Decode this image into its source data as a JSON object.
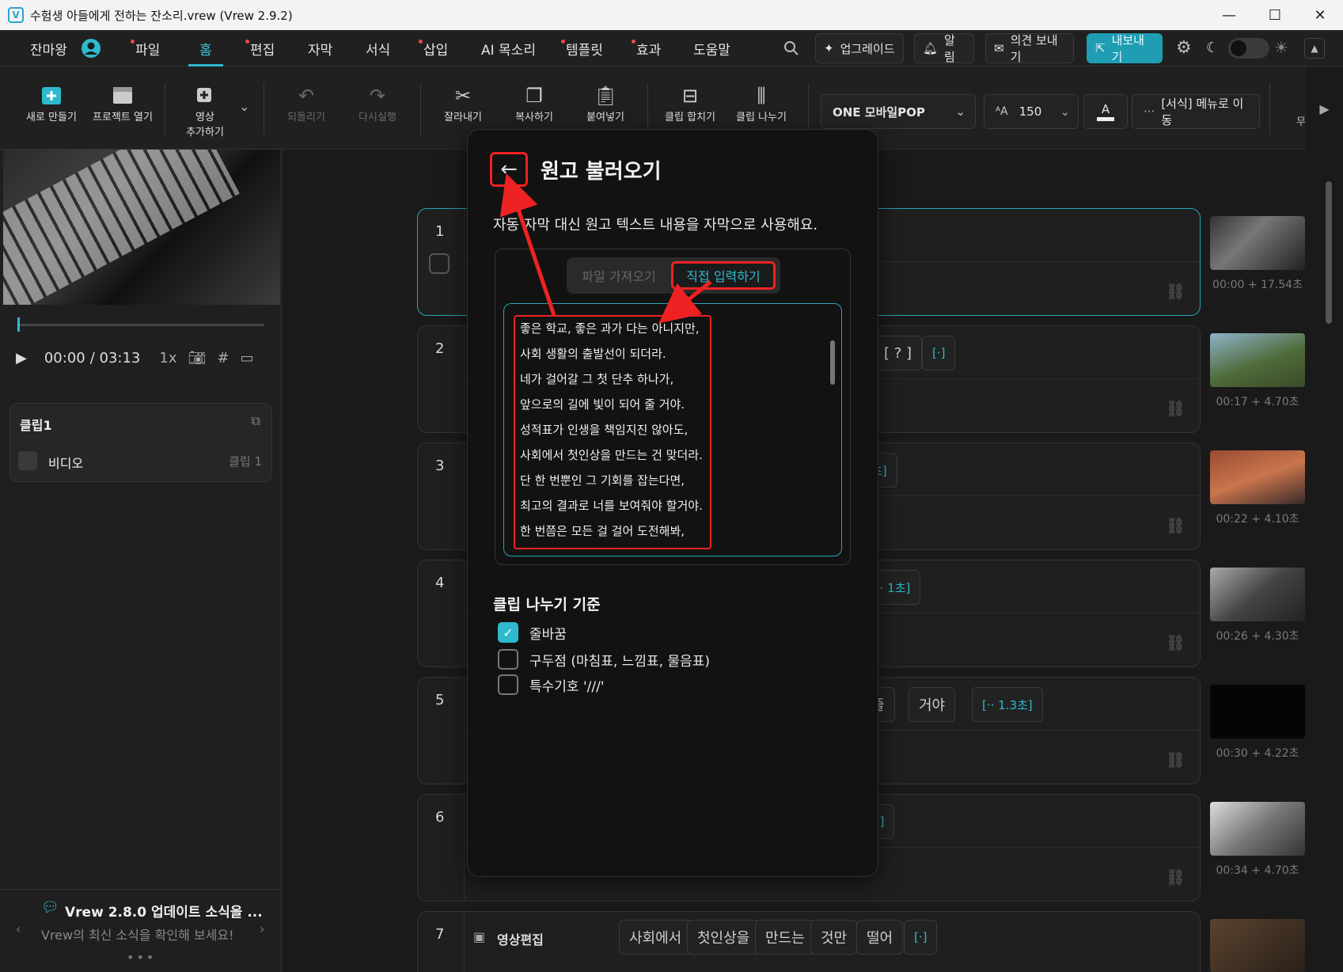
{
  "window": {
    "title": "수험생 아들에게 전하는 잔소리.vrew (Vrew 2.9.2)",
    "logo_text": "V",
    "controls": [
      "—",
      "☐",
      "✕"
    ]
  },
  "menubar": {
    "user": "잔마왕",
    "items": [
      {
        "label": "파일",
        "dot": true
      },
      {
        "label": "홈",
        "dot": false,
        "active": true
      },
      {
        "label": "편집",
        "dot": true
      },
      {
        "label": "자막",
        "dot": false
      },
      {
        "label": "서식",
        "dot": false
      },
      {
        "label": "삽입",
        "dot": true
      },
      {
        "label": "AI 목소리",
        "dot": false
      },
      {
        "label": "템플릿",
        "dot": true
      },
      {
        "label": "효과",
        "dot": true
      },
      {
        "label": "도움말",
        "dot": false
      }
    ],
    "upgrade": "업그레이드",
    "alarm": "알림",
    "feedback": "의견 보내기",
    "export": "내보내기"
  },
  "toolbar": {
    "new": "새로 만들기",
    "open": "프로젝트 열기",
    "add_video_1": "영상",
    "add_video_2": "추가하기",
    "undo": "되돌리기",
    "redo": "다시실행",
    "cut": "잘라내기",
    "copy": "복사하기",
    "paste": "붙여넣기",
    "merge": "클립 합치기",
    "split": "클립 나누기",
    "font": "ONE 모바일POP",
    "font_size": "150",
    "font_color_label": "A",
    "format_menu": "[서식] 메뉴로 이동",
    "more": "무"
  },
  "player": {
    "current": "00:00",
    "total": "/ 03:13",
    "speed": "1x"
  },
  "clip_panel": {
    "title": "클립1",
    "item": "비디오",
    "item_meta": "클립 1"
  },
  "news": {
    "title": "Vrew 2.8.0 업데이트 소식을 ...",
    "body": "Vrew의 최신 소식을 확인해 보세요!"
  },
  "rows": [
    {
      "num": "1",
      "time": "00:00 + 17.54초"
    },
    {
      "num": "2",
      "time": "00:17 + 4.70초",
      "words": [
        "[ ? ]",
        "[·]"
      ]
    },
    {
      "num": "3",
      "time": "00:22 + 4.10초",
      "words": [
        "초]"
      ]
    },
    {
      "num": "4",
      "time": "00:26 + 4.30초",
      "words": [
        "[·· 1초]"
      ]
    },
    {
      "num": "5",
      "time": "00:30 + 4.22초",
      "words": [
        "줄",
        "거야",
        "[·· 1.3초]"
      ]
    },
    {
      "num": "6",
      "time": "00:34 + 4.70초",
      "words": [
        "[·]"
      ]
    },
    {
      "num": "7",
      "label": "영상편집",
      "words": [
        "사회에서",
        "첫인상을",
        "만드는",
        "것만",
        "떨어",
        "[·]"
      ]
    }
  ],
  "modal": {
    "title": "원고 불러오기",
    "description": "자동 자막 대신 원고 텍스트 내용을 자막으로 사용해요.",
    "tab_file": "파일 가져오기",
    "tab_direct": "직접 입력하기",
    "lines": [
      "좋은 학교, 좋은 과가 다는 아니지만,",
      "사회 생활의 출발선이 되더라.",
      "네가 걸어갈 그 첫 단추 하나가,",
      "앞으로의 길에 빛이 되어 줄 거야.",
      "성적표가 인생을 책임지진 않아도,",
      "사회에서 첫인상을 만드는 건 맞더라.",
      "단 한 번뿐인 그 기회를 잡는다면,",
      "최고의 결과로 너를 보여줘야 할거야.",
      "한 번쯤은 모든 걸 걸어 도전해봐,"
    ],
    "split_title": "클립 나누기 기준",
    "options": [
      {
        "label": "줄바꿈",
        "checked": true
      },
      {
        "label": "구두점 (마침표, 느낌표, 물음표)",
        "checked": false
      },
      {
        "label": "특수기호 '///'",
        "checked": false
      }
    ]
  },
  "colors": {
    "accent": "#2fb9cc",
    "annotation": "#ee2222",
    "background": "#1a1a1a"
  }
}
